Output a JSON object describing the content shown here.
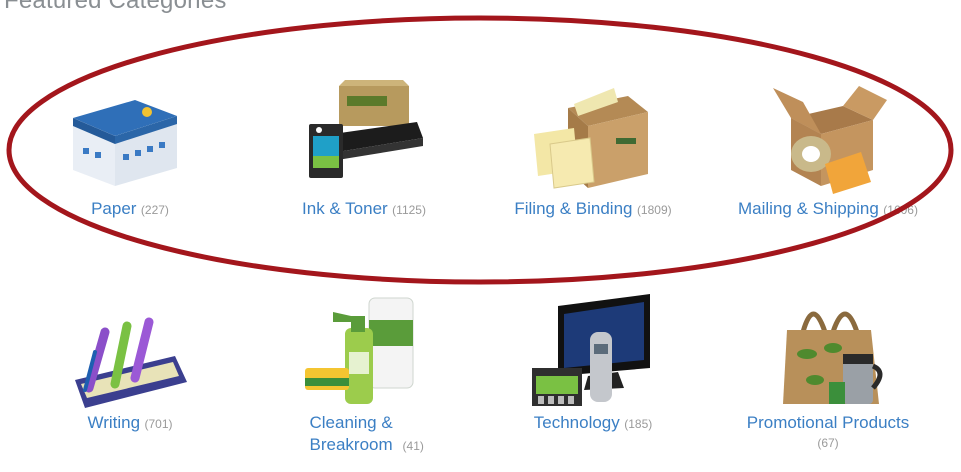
{
  "heading": "Featured Categories",
  "categories": [
    {
      "label": "Paper",
      "count": "(227)",
      "icon": "paper-ream-icon"
    },
    {
      "label": "Ink & Toner",
      "count": "(1125)",
      "icon": "ink-toner-icon"
    },
    {
      "label": "Filing & Binding",
      "count": "(1809)",
      "icon": "file-box-icon"
    },
    {
      "label": "Mailing & Shipping",
      "count": "(1606)",
      "icon": "shipping-box-icon"
    },
    {
      "label": "Writing",
      "count": "(701)",
      "icon": "pens-highlighters-icon"
    },
    {
      "label": "Cleaning & Breakroom",
      "count": "(41)",
      "icon": "cleaning-supplies-icon"
    },
    {
      "label": "Technology",
      "count": "(185)",
      "icon": "monitor-phone-icon"
    },
    {
      "label": "Promotional Products",
      "count": "(67)",
      "icon": "tote-mug-icon"
    }
  ],
  "highlight_color": "#a3161c",
  "link_color": "#3b7fc4"
}
